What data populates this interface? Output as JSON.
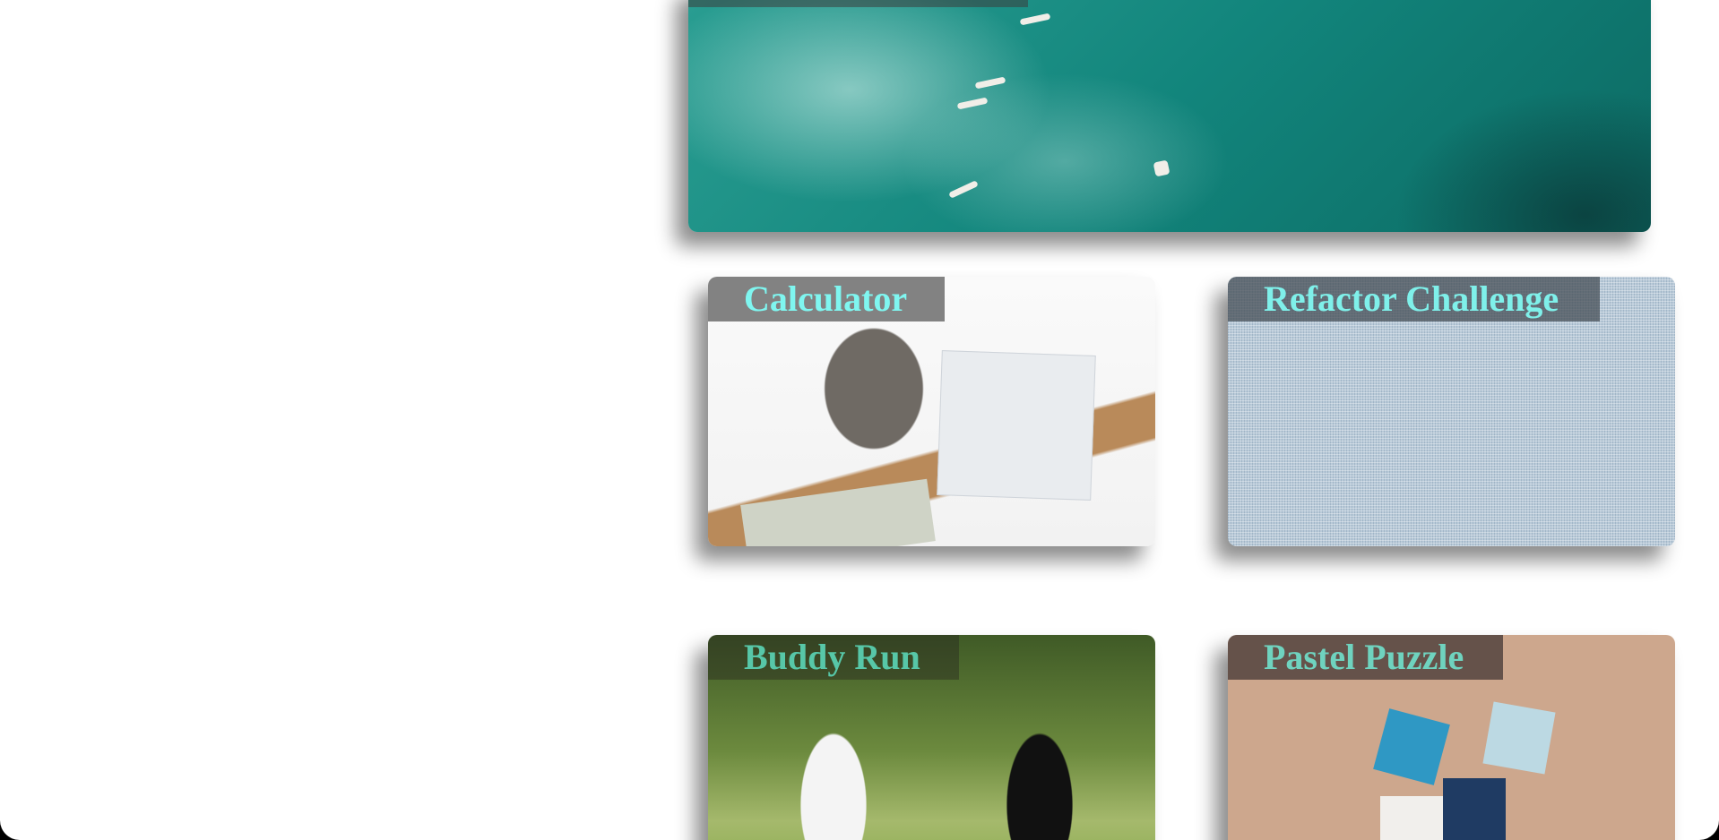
{
  "projects": [
    {
      "title": "",
      "image": "surfers-ocean"
    },
    {
      "title": "Calculator",
      "image": "calculator-desk"
    },
    {
      "title": "Refactor Challenge",
      "image": "blue-fabric-texture"
    },
    {
      "title": "Buddy Run",
      "image": "two-women-running"
    },
    {
      "title": "Pastel Puzzle",
      "image": "hands-puzzle-pieces"
    }
  ],
  "colors": {
    "title_text": "#7ff6f0",
    "page_bg": "#ffffff"
  }
}
